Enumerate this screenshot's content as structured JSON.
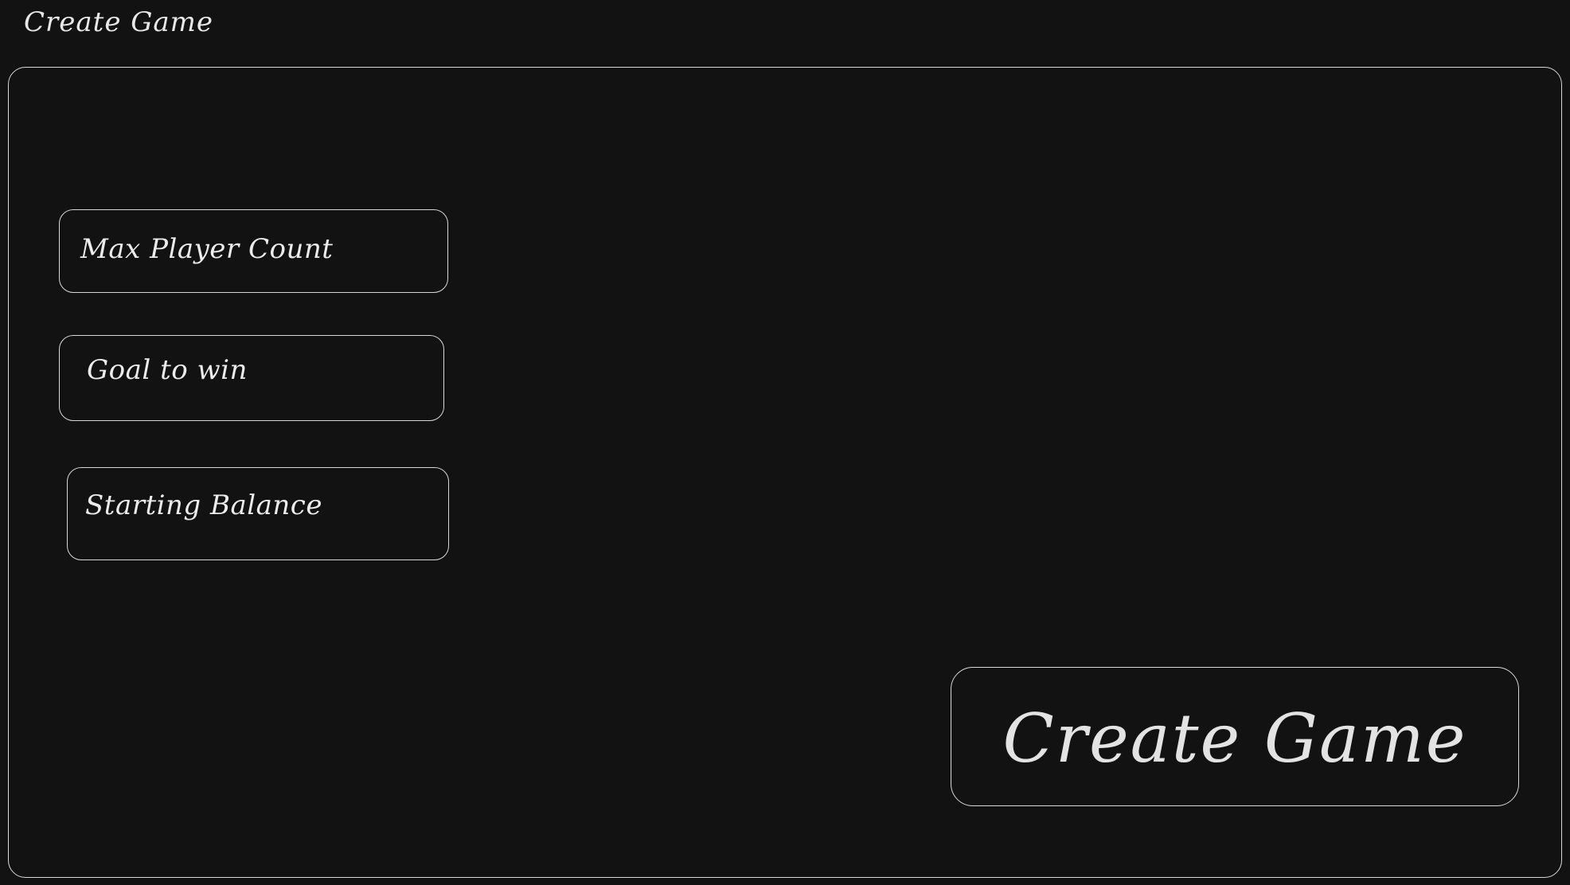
{
  "page": {
    "title": "Create Game"
  },
  "form": {
    "fields": [
      {
        "label": "Max Player Count"
      },
      {
        "label": "Goal to win"
      },
      {
        "label": "Starting Balance"
      }
    ],
    "submit_label": "Create Game"
  },
  "colors": {
    "background": "#121212",
    "stroke": "#d8d8d8",
    "text": "#e6e6e6"
  }
}
